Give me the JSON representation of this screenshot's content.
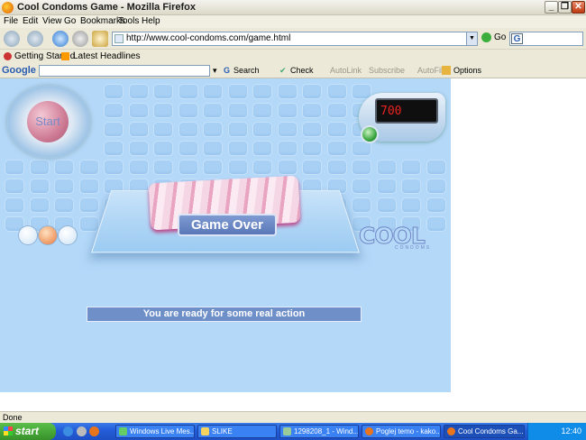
{
  "window": {
    "title": "Cool Condoms Game - Mozilla Firefox"
  },
  "menu": [
    "File",
    "Edit",
    "View",
    "Go",
    "Bookmarks",
    "Tools",
    "Help"
  ],
  "nav": {
    "url": "http://www.cool-condoms.com/game.html",
    "go_label": "Go"
  },
  "bookmarks": [
    "Getting Started",
    "Latest Headlines"
  ],
  "google_toolbar": {
    "brand": "Google",
    "search": "Search",
    "check": "Check",
    "autolink": "AutoLink",
    "subscribe": "Subscribe",
    "autofill": "AutoFill",
    "options": "Options"
  },
  "game": {
    "start_label": "Start",
    "score": "700",
    "game_over": "Game Over",
    "logo": "COOL",
    "logo_sub": "CONDOMS",
    "message": "You are ready for some real action"
  },
  "status": "Done",
  "taskbar": {
    "start": "start",
    "tasks": [
      "Windows Live Mes...",
      "SLIKE",
      "1298208_1 - Wind...",
      "Poglej temo - kako...",
      "Cool Condoms Ga..."
    ],
    "clock": "12:40"
  },
  "colors": {
    "game_bg": "#b4d8f8",
    "score_digits": "#e22222",
    "taskbar": "#245edb"
  }
}
